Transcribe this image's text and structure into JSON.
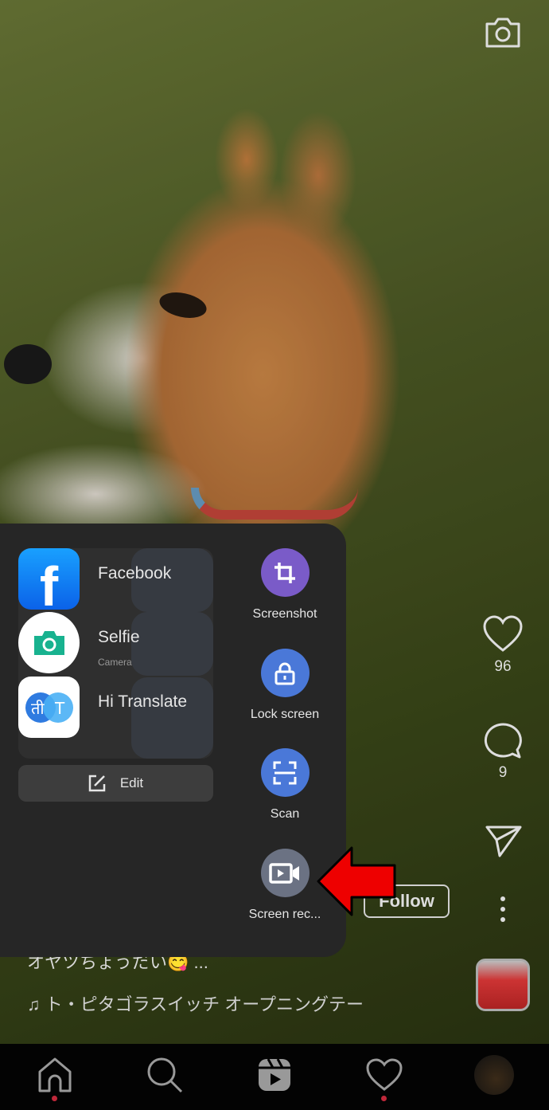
{
  "post": {
    "caption": "オヤツちょうだい😋 ...",
    "music": "ト・ピタゴラスイッチ オープニングテー",
    "likes": "96",
    "comments": "9",
    "follow_label": "Follow"
  },
  "smart_sidebar": {
    "apps": [
      {
        "label": "Facebook",
        "icon": "facebook-icon"
      },
      {
        "label": "Selfie",
        "sublabel": "Camera",
        "icon": "camera-icon"
      },
      {
        "label": "Hi Translate",
        "icon": "translate-icon"
      }
    ],
    "edit_label": "Edit",
    "tools": [
      {
        "label": "Screenshot",
        "icon": "crop-icon",
        "color": "#7a5bc8"
      },
      {
        "label": "Lock screen",
        "icon": "lock-icon",
        "color": "#4a78d8"
      },
      {
        "label": "Scan",
        "icon": "scan-icon",
        "color": "#4a78d8"
      },
      {
        "label": "Screen rec...",
        "icon": "video-record-icon",
        "color": "#6b7283"
      }
    ]
  },
  "nav": [
    "home-icon",
    "search-icon",
    "reels-icon",
    "heart-icon",
    "profile-avatar"
  ],
  "colors": {
    "annotation_arrow": "#ee0000",
    "notification_dot": "#c0283a"
  }
}
